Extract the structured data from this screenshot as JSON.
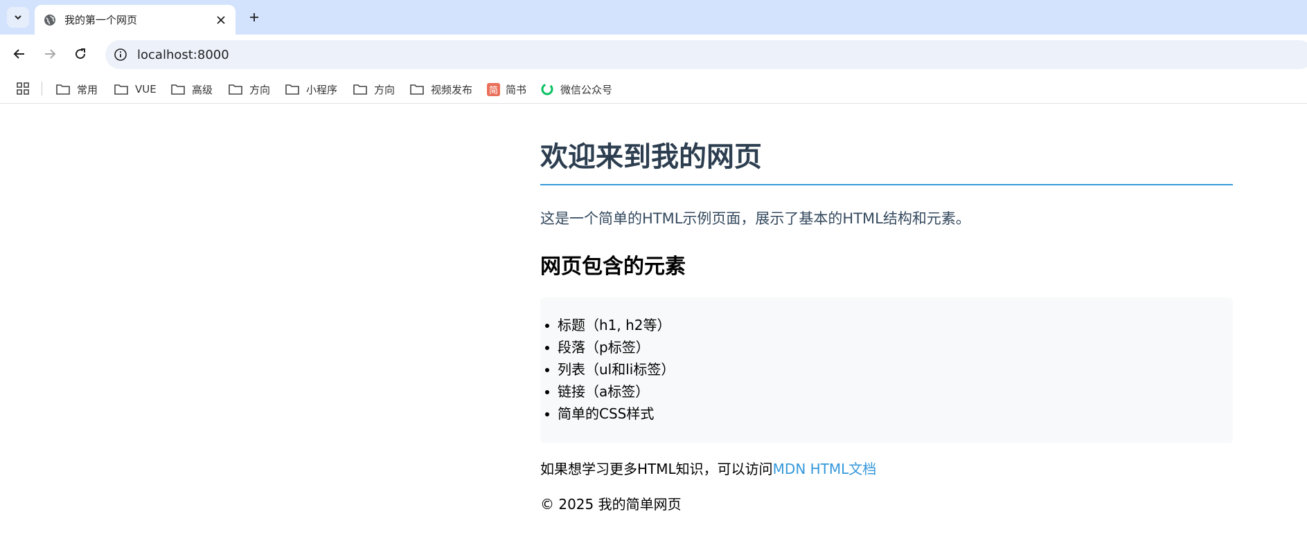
{
  "browser": {
    "tab": {
      "title": "我的第一个网页"
    },
    "address": {
      "url": "localhost:8000"
    },
    "bookmarks": [
      {
        "label": "常用",
        "icon": "folder-icon"
      },
      {
        "label": "VUE",
        "icon": "folder-icon"
      },
      {
        "label": "高级",
        "icon": "folder-icon"
      },
      {
        "label": "方向",
        "icon": "folder-icon"
      },
      {
        "label": "小程序",
        "icon": "folder-icon"
      },
      {
        "label": "方向",
        "icon": "folder-icon"
      },
      {
        "label": "视频发布",
        "icon": "folder-icon"
      },
      {
        "label": "简书",
        "icon": "jianshu-icon",
        "icon_text": "简"
      },
      {
        "label": "微信公众号",
        "icon": "wechat-icon"
      }
    ]
  },
  "page": {
    "title": "欢迎来到我的网页",
    "intro": "这是一个简单的HTML示例页面，展示了基本的HTML结构和元素。",
    "section_title": "网页包含的元素",
    "items": [
      "标题（h1, h2等）",
      "段落（p标签）",
      "列表（ul和li标签）",
      "链接（a标签）",
      "简单的CSS样式"
    ],
    "more_text": "如果想学习更多HTML知识，可以访问",
    "more_link": "MDN HTML文档",
    "footer": "© 2025 我的简单网页"
  },
  "colors": {
    "tabstrip_bg": "#d3e3fd",
    "heading": "#2c3e50",
    "accent": "#3498db",
    "list_bg": "#f8f9fa",
    "jianshu": "#ea6f5a",
    "wechat": "#07c160"
  }
}
